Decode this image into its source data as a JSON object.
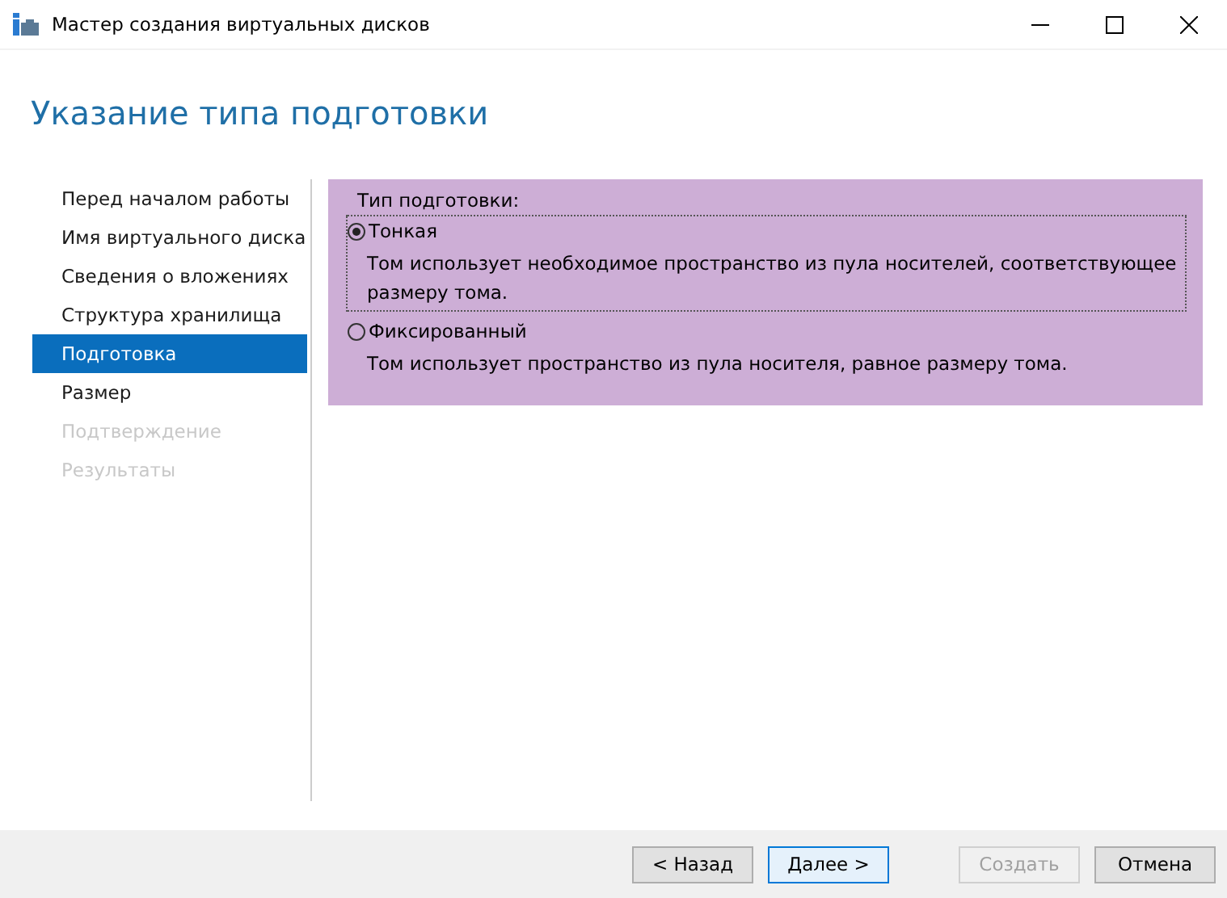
{
  "window": {
    "title": "Мастер создания виртуальных дисков",
    "controls": [
      {
        "kind": "minimize"
      },
      {
        "kind": "maximize"
      },
      {
        "kind": "close"
      }
    ]
  },
  "heading": "Указание типа подготовки",
  "steps": [
    {
      "label": "Перед началом работы",
      "selected": false,
      "disabled": false
    },
    {
      "label": "Имя виртуального диска",
      "selected": false,
      "disabled": false
    },
    {
      "label": "Сведения о вложениях",
      "selected": false,
      "disabled": false
    },
    {
      "label": "Структура хранилища",
      "selected": false,
      "disabled": false
    },
    {
      "label": "Подготовка",
      "selected": true,
      "disabled": false
    },
    {
      "label": "Размер",
      "selected": false,
      "disabled": false
    },
    {
      "label": "Подтверждение",
      "selected": false,
      "disabled": true
    },
    {
      "label": "Результаты",
      "selected": false,
      "disabled": true
    }
  ],
  "provisioning": {
    "label": "Тип подготовки:",
    "options": [
      {
        "label": "Тонкая",
        "description": "Том использует необходимое пространство из пула носителей, соответствующее размеру тома.",
        "selected": true,
        "focused": true
      },
      {
        "label": "Фиксированный",
        "description": "Том использует пространство из пула носителя, равное размеру тома.",
        "selected": false,
        "focused": false
      }
    ]
  },
  "buttons": [
    {
      "label": "< Назад",
      "disabled": false,
      "default": false
    },
    {
      "label": "Далее >",
      "disabled": false,
      "default": true
    },
    {
      "label": "Создать",
      "disabled": true,
      "default": false
    },
    {
      "label": "Отмена",
      "disabled": false,
      "default": false
    }
  ]
}
